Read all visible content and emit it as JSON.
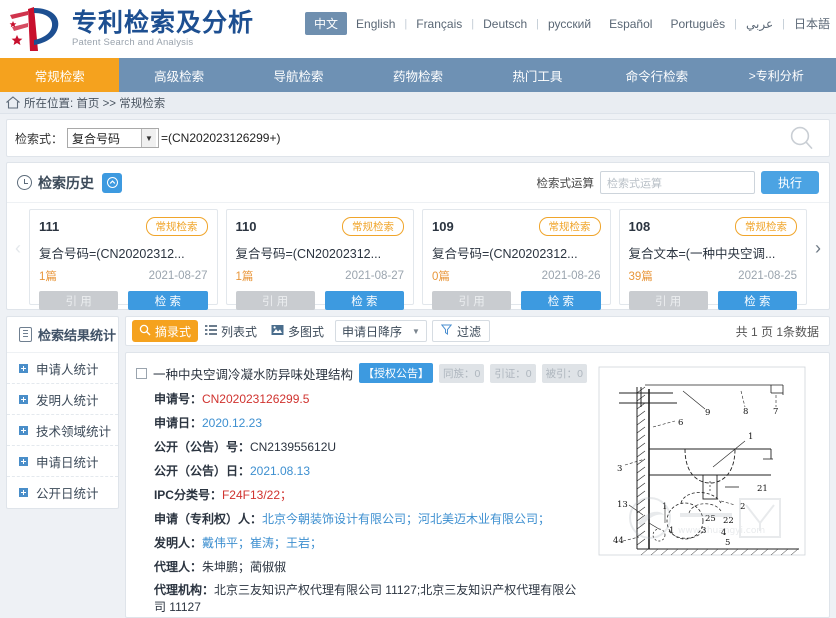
{
  "header": {
    "logo_cn": "专利检索及分析",
    "logo_en": "Patent Search and Analysis",
    "languages": [
      {
        "label": "中文",
        "active": true
      },
      {
        "label": "English",
        "active": false
      },
      {
        "label": "Français",
        "active": false
      },
      {
        "label": "Deutsch",
        "active": false
      },
      {
        "label": "русский",
        "active": false
      },
      {
        "label": "Español",
        "active": false
      },
      {
        "label": "Português",
        "active": false
      },
      {
        "label": "عربي",
        "active": false
      },
      {
        "label": "日本語",
        "active": false
      }
    ]
  },
  "nav": {
    "tabs": [
      {
        "label": "常规检索",
        "active": true
      },
      {
        "label": "高级检索",
        "active": false
      },
      {
        "label": "导航检索",
        "active": false
      },
      {
        "label": "药物检索",
        "active": false
      },
      {
        "label": "热门工具",
        "active": false
      },
      {
        "label": "命令行检索",
        "active": false
      },
      {
        "label": ">专利分析",
        "active": false
      }
    ]
  },
  "breadcrumb": {
    "text": "所在位置: 首页 >> 常规检索"
  },
  "search": {
    "label": "检索式：",
    "field_selected": "复合号码",
    "expression": "=(CN202023126299+)",
    "magnifier_icon": "search-icon"
  },
  "history": {
    "title": "检索历史",
    "collapse_icon": "chevron-up-icon",
    "op_label": "检索式运算",
    "op_placeholder": "检索式运算",
    "exec_label": "执行",
    "prev_icon": "chevron-left-icon",
    "next_icon": "chevron-right-icon",
    "cards": [
      {
        "num": "111",
        "tag": "常规检索",
        "expr": "复合号码=(CN20202312...",
        "count": "1篇",
        "date": "2021-08-27",
        "cite": "引 用",
        "search": "检 索"
      },
      {
        "num": "110",
        "tag": "常规检索",
        "expr": "复合号码=(CN20202312...",
        "count": "1篇",
        "date": "2021-08-27",
        "cite": "引 用",
        "search": "检 索"
      },
      {
        "num": "109",
        "tag": "常规检索",
        "expr": "复合号码=(CN20202312...",
        "count": "0篇",
        "date": "2021-08-26",
        "cite": "引 用",
        "search": "检 索"
      },
      {
        "num": "108",
        "tag": "常规检索",
        "expr": "复合文本=(一种中央空调...",
        "count": "39篇",
        "date": "2021-08-25",
        "cite": "引 用",
        "search": "检 索"
      }
    ]
  },
  "sidebar": {
    "title": "检索结果统计",
    "title_icon": "clipboard-icon",
    "items": [
      {
        "label": "申请人统计"
      },
      {
        "label": "发明人统计"
      },
      {
        "label": "技术领域统计"
      },
      {
        "label": "申请日统计"
      },
      {
        "label": "公开日统计"
      }
    ]
  },
  "toolbar": {
    "view_table": "摘录式",
    "view_table_icon": "magnifier-doc-icon",
    "view_list": "列表式",
    "view_list_icon": "list-icon",
    "view_multi": "多图式",
    "view_multi_icon": "image-icon",
    "sort_selected": "申请日降序",
    "sort_caret_icon": "chevron-down-icon",
    "filter_label": "过滤",
    "filter_icon": "funnel-icon",
    "count_text": "共 1 页 1条数据"
  },
  "result": {
    "title": "一种中央空调冷凝水防异味处理结构",
    "badge_main": "【授权公告】",
    "badges": [
      "同族：0",
      "引证：0",
      "被引：0"
    ],
    "fields": [
      {
        "key": "申请号：",
        "value": "CN202023126299.5",
        "color": "red"
      },
      {
        "key": "申请日：",
        "value": "2020.12.23",
        "color": "blue"
      },
      {
        "key": "公开（公告）号：",
        "value": "CN213955612U",
        "color": "grey"
      },
      {
        "key": "公开（公告）日：",
        "value": "2021.08.13",
        "color": "blue"
      },
      {
        "key": "IPC分类号：",
        "value": "F24F13/22；",
        "color": "red"
      },
      {
        "key": "申请（专利权）人：",
        "value": "北京今朝装饰设计有限公司；河北美迈木业有限公司；",
        "color": "blue"
      },
      {
        "key": "发明人：",
        "value": "戴伟平；崔涛；王岩；",
        "color": "blue"
      },
      {
        "key": "代理人：",
        "value": "朱坤鹏；蔺俶俶",
        "color": "grey"
      },
      {
        "key": "代理机构：",
        "value": "北京三友知识产权代理有限公司 11127;北京三友知识产权代理有限公司 11127",
        "color": "grey"
      }
    ],
    "drawing_labels": [
      "9",
      "8",
      "7",
      "6",
      "1",
      "3",
      "21",
      "2",
      "13",
      "4",
      "25",
      "22",
      "44",
      "5"
    ],
    "watermark": "zhuangyi"
  }
}
